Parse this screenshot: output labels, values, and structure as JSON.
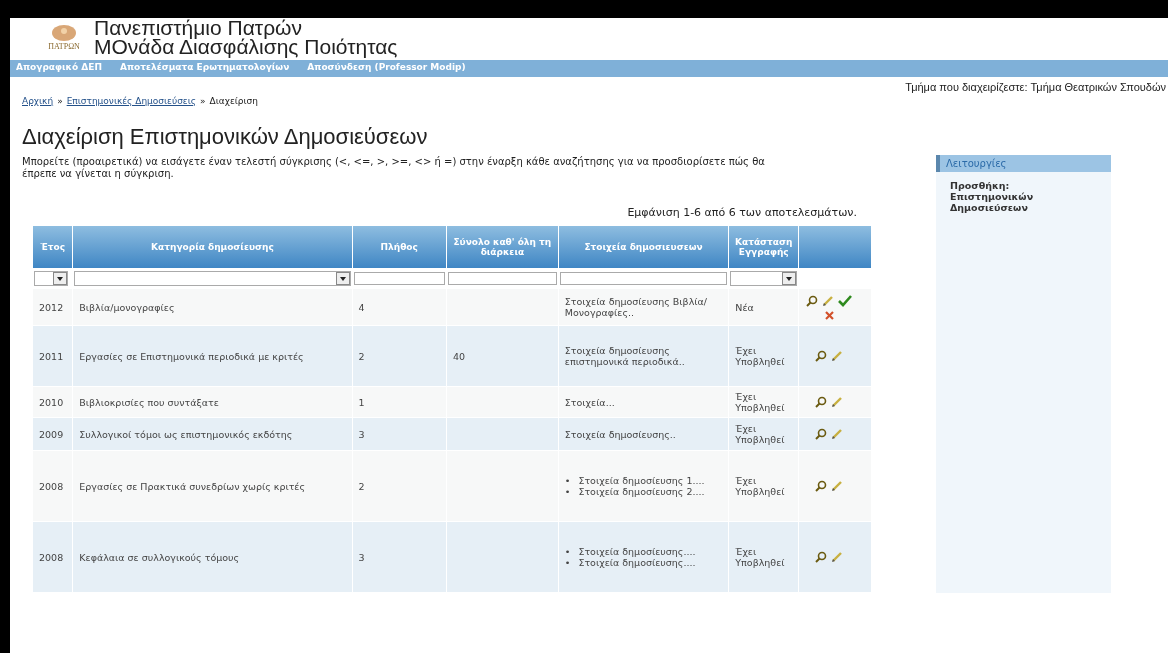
{
  "header": {
    "title_line_1": "Πανεπιστήμιο Πατρών",
    "title_line_2": "ΜΟνάδα Διασφάλισης Ποιότητας",
    "logo_text": "ΠΑΤΡΩΝ"
  },
  "nav": {
    "items": [
      "Απογραφικό ΔΕΠ",
      "Αποτελέσματα Ερωτηματολογίων",
      "Αποσύνδεση (Professor Modip)"
    ]
  },
  "department": "Τμήμα που διαχειρίζεστε: Τμήμα Θεατρικών Σπουδών",
  "breadcrumb": [
    {
      "label": "Αρχική",
      "link": true
    },
    {
      "label": "Επιστημονικές Δημοσιεύσεις",
      "link": true
    },
    {
      "label": "Διαχείριση",
      "link": false
    }
  ],
  "breadcrumb_separator": "»",
  "page_title": "Διαχείριση Επιστημονικών Δημοσιεύσεων",
  "intro": "Μπορείτε (προαιρετικά) να εισάγετε έναν τελεστή σύγκρισης (<, <=, >, >=, <> ή =) στην έναρξη κάθε αναζήτησης για να προσδιορίσετε πώς θα έπρεπε να γίνεται η σύγκριση.",
  "summary": "Εμφάνιση 1-6 από 6 των αποτελεσμάτων.",
  "table": {
    "columns": [
      "Έτος",
      "Κατηγορία δημοσίευσης",
      "Πλήθος",
      "Σύνολο καθ' όλη τη διάρκεια",
      "Στοιχεία δημοσιευσεων",
      "Κατάσταση Εγγραφής",
      ""
    ],
    "filters": [
      {
        "kind": "select"
      },
      {
        "kind": "select"
      },
      {
        "kind": "input"
      },
      {
        "kind": "input"
      },
      {
        "kind": "input"
      },
      {
        "kind": "select"
      },
      {
        "kind": "none"
      }
    ],
    "rows": [
      {
        "year": "2012",
        "category": "Βιβλία/μονογραφίες",
        "count": "4",
        "total": "",
        "details": [
          {
            "kind": "text",
            "text": "Στοιχεία δημοσίευσης Βιβλία/Μονογραφίες.."
          }
        ],
        "status": "Νέα",
        "actions": [
          {
            "kind": "view"
          },
          {
            "kind": "edit"
          },
          {
            "kind": "approve"
          },
          {
            "kind": "delete"
          }
        ]
      },
      {
        "year": "2011",
        "category": "Εργασίες σε Επιστημονικά περιοδικά με κριτές",
        "count": "2",
        "total": "40",
        "details": [
          {
            "kind": "text",
            "text": "Στοιχεία δημοσίευσης επιστημονικά περιοδικά.."
          }
        ],
        "status": "Έχει Υποβληθεί",
        "actions": [
          {
            "kind": "view"
          },
          {
            "kind": "edit"
          }
        ]
      },
      {
        "year": "2010",
        "category": "Βιβλιοκρισίες που συντάξατε",
        "count": "1",
        "total": "",
        "details": [
          {
            "kind": "text",
            "text": "Στοιχεία..."
          }
        ],
        "status": "Έχει Υποβληθεί",
        "actions": [
          {
            "kind": "view"
          },
          {
            "kind": "edit"
          }
        ]
      },
      {
        "year": "2009",
        "category": "Συλλογικοί τόμοι ως επιστημονικός εκδότης",
        "count": "3",
        "total": "",
        "details": [
          {
            "kind": "text",
            "text": "Στοιχεία δημοσίευσης.."
          }
        ],
        "status": "Έχει Υποβληθεί",
        "actions": [
          {
            "kind": "view"
          },
          {
            "kind": "edit"
          }
        ]
      },
      {
        "year": "2008",
        "category": "Εργασίες σε Πρακτικά συνεδρίων χωρίς κριτές",
        "count": "2",
        "total": "",
        "details": [
          {
            "kind": "bullet",
            "marker": "•",
            "text": "Στοιχεία δημοσίευσης 1...."
          },
          {
            "kind": "bullet",
            "marker": "•",
            "text": "Στοιχεία δημοσίευσης 2...."
          }
        ],
        "status": "Έχει Υποβληθεί",
        "actions": [
          {
            "kind": "view"
          },
          {
            "kind": "edit"
          }
        ]
      },
      {
        "year": "2008",
        "category": "Κεφάλαια σε συλλογικούς τόμους",
        "count": "3",
        "total": "",
        "details": [
          {
            "kind": "bullet",
            "marker": "•",
            "text": "Στοιχεία δημοσίευσης...."
          },
          {
            "kind": "bullet",
            "marker": "•",
            "text": "Στοιχεία δημοσίευσης...."
          }
        ],
        "status": "Έχει Υποβληθεί",
        "actions": [
          {
            "kind": "view"
          },
          {
            "kind": "edit"
          }
        ]
      }
    ]
  },
  "sidebar": {
    "title": "Λειτουργίες",
    "items": [
      "Προσθήκη: Επιστημονικών Δημοσιεύσεων"
    ]
  }
}
